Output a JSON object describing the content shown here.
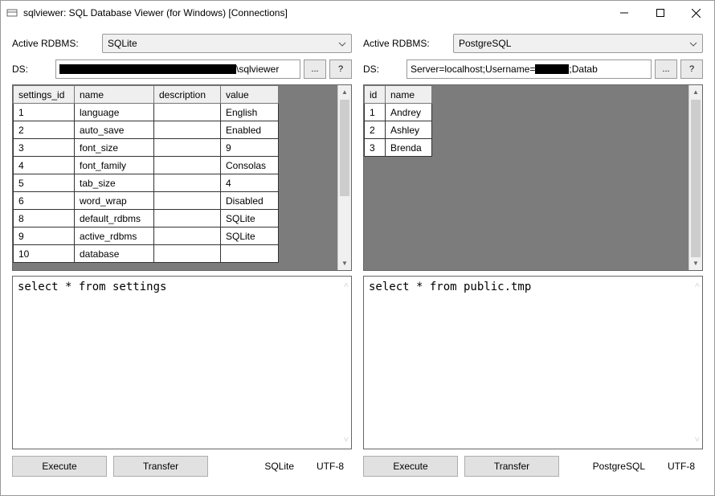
{
  "window": {
    "title": "sqlviewer: SQL Database Viewer (for Windows) [Connections]"
  },
  "left": {
    "rdbms_label": "Active RDBMS:",
    "rdbms_value": "SQLite",
    "ds_label": "DS:",
    "ds_suffix": "\\sqlviewer",
    "browse_label": "...",
    "help_label": "?",
    "table": {
      "columns": [
        "settings_id",
        "name",
        "description",
        "value"
      ],
      "rows": [
        [
          "1",
          "language",
          "",
          "English"
        ],
        [
          "2",
          "auto_save",
          "",
          "Enabled"
        ],
        [
          "3",
          "font_size",
          "",
          "9"
        ],
        [
          "4",
          "font_family",
          "",
          "Consolas"
        ],
        [
          "5",
          "tab_size",
          "",
          "4"
        ],
        [
          "6",
          "word_wrap",
          "",
          "Disabled"
        ],
        [
          "8",
          "default_rdbms",
          "",
          "SQLite"
        ],
        [
          "9",
          "active_rdbms",
          "",
          "SQLite"
        ],
        [
          "10",
          "database",
          "",
          ""
        ]
      ]
    },
    "sql": "select * from settings",
    "execute_label": "Execute",
    "transfer_label": "Transfer",
    "status_rdbms": "SQLite",
    "status_enc": "UTF-8"
  },
  "right": {
    "rdbms_label": "Active RDBMS:",
    "rdbms_value": "PostgreSQL",
    "ds_label": "DS:",
    "ds_prefix": "Server=localhost;Username=",
    "ds_suffix": ";Datab",
    "browse_label": "...",
    "help_label": "?",
    "table": {
      "columns": [
        "id",
        "name"
      ],
      "rows": [
        [
          "1",
          "Andrey"
        ],
        [
          "2",
          "Ashley"
        ],
        [
          "3",
          "Brenda"
        ]
      ]
    },
    "sql": "select * from public.tmp",
    "execute_label": "Execute",
    "transfer_label": "Transfer",
    "status_rdbms": "PostgreSQL",
    "status_enc": "UTF-8"
  }
}
